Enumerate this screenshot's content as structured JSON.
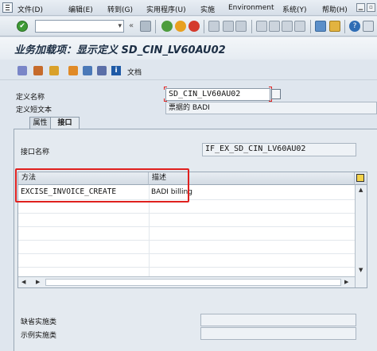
{
  "menu": {
    "items": [
      "文件(D)",
      "编辑(E)",
      "转到(G)",
      "实用程序(U)",
      "实施",
      "Environment",
      "系统(Y)",
      "帮助(H)"
    ]
  },
  "toolbar": {
    "command_value": ""
  },
  "title": "业务加载项：显示定义 SD_CIN_LV60AU02",
  "app_toolbar": {
    "documentation_label": "文档"
  },
  "fields": {
    "definition_name": {
      "label": "定义名称",
      "value": "SD_CIN_LV60AU02"
    },
    "short_text": {
      "label": "定义短文本",
      "value": "票据的 BADI"
    }
  },
  "tabs": [
    {
      "label": "属性",
      "active": false
    },
    {
      "label": "接口",
      "active": true
    }
  ],
  "interface": {
    "label": "接口名称",
    "value": "IF_EX_SD_CIN_LV60AU02"
  },
  "methods_table": {
    "columns": [
      "方法",
      "描述"
    ],
    "rows": [
      {
        "method": "EXCISE_INVOICE_CREATE",
        "description": "BADI billing"
      }
    ]
  },
  "bottom_fields": {
    "default_impl": {
      "label": "缺省实施类",
      "value": ""
    },
    "example_impl": {
      "label": "示例实施类",
      "value": ""
    }
  },
  "colors": {
    "highlight": "#e0201e",
    "ok_green": "#3e9a35",
    "title_text": "#1c2e44"
  }
}
